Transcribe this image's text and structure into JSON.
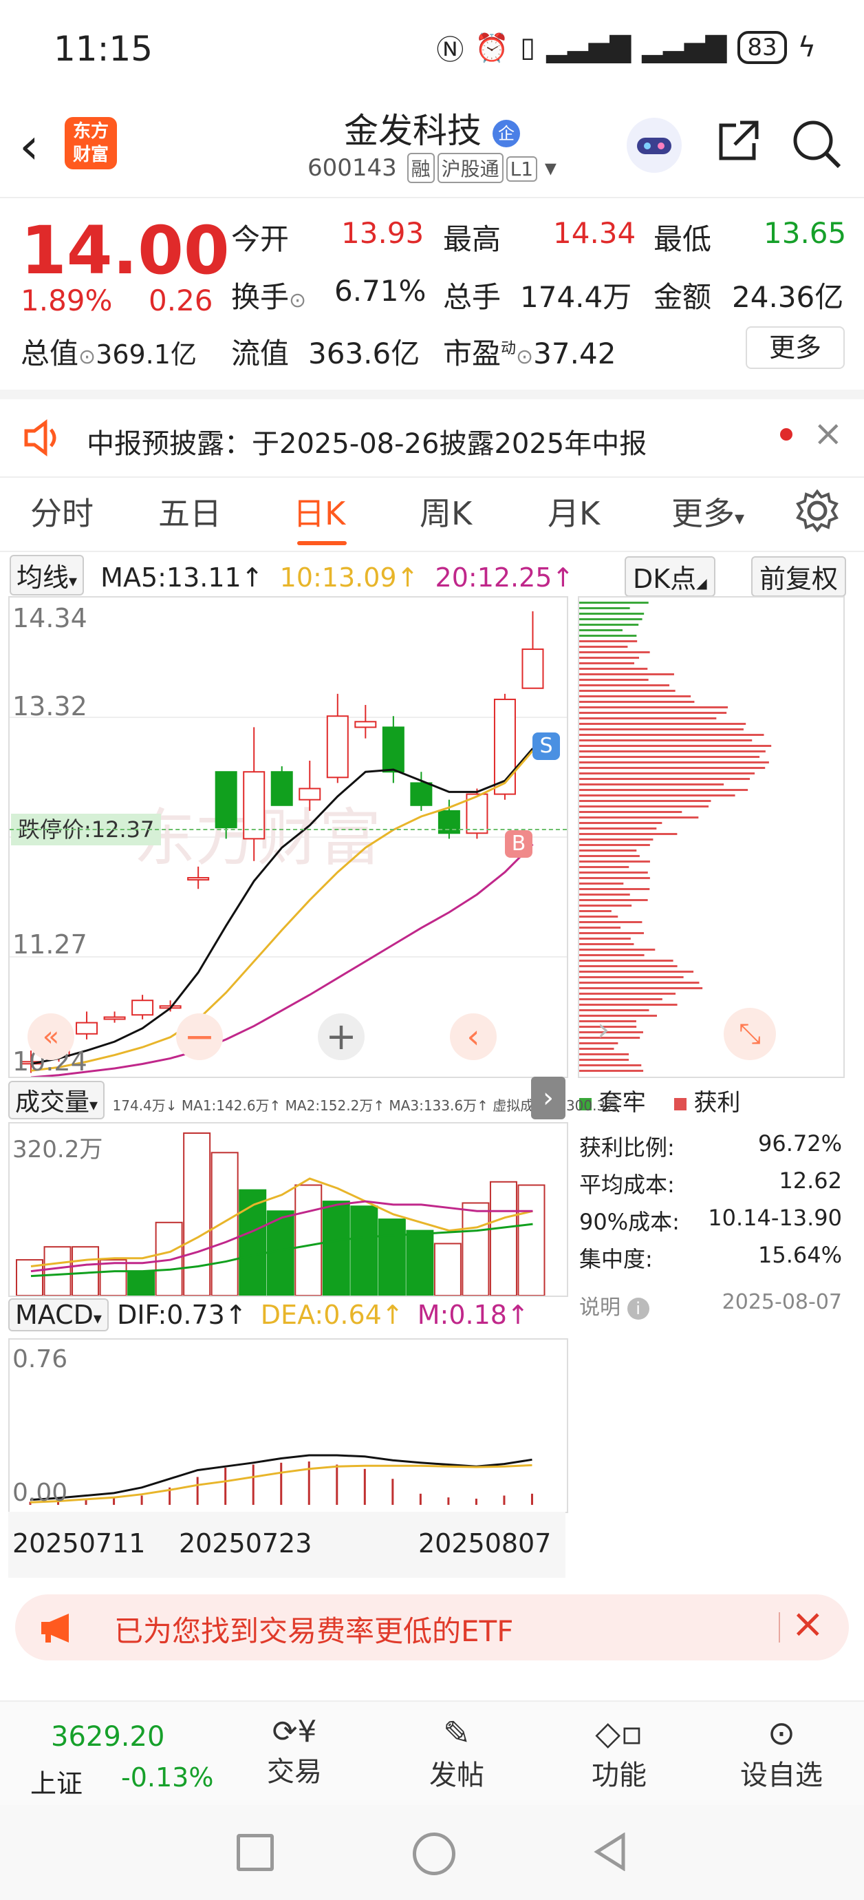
{
  "status": {
    "time": "11:15",
    "battery": "83"
  },
  "header": {
    "logo_line1": "东方",
    "logo_line2": "财富",
    "stock_name": "金发科技",
    "corp_badge": "企",
    "code": "600143",
    "tags": [
      "融",
      "沪股通",
      "L1"
    ]
  },
  "quote": {
    "price": "14.00",
    "change_pct": "1.89%",
    "change": "0.26",
    "open_label": "今开",
    "open": "13.93",
    "high_label": "最高",
    "high": "14.34",
    "low_label": "最低",
    "low": "13.65",
    "turnover_label": "换手",
    "turnover": "6.71%",
    "volume_label": "总手",
    "volume": "174.4万",
    "amount_label": "金额",
    "amount": "24.36亿",
    "mcap_label": "总值",
    "mcap": "369.1亿",
    "float_label": "流值",
    "float": "363.6亿",
    "pe_label": "市盈",
    "pe_sup": "动",
    "pe": "37.42",
    "more": "更多"
  },
  "notice": {
    "text": "中报预披露：于2025-08-26披露2025年中报"
  },
  "tabs": [
    "分时",
    "五日",
    "日K",
    "周K",
    "月K",
    "更多"
  ],
  "ma": {
    "selector": "均线",
    "ma5": "MA5:13.11↑",
    "ma10": "10:13.09↑",
    "ma20": "20:12.25↑",
    "dk": "DK点",
    "adjust": "前复权"
  },
  "kchart": {
    "y_top": "14.34",
    "y_2": "13.32",
    "y_3": "11.27",
    "y_bottom": "10.24",
    "stop_label": "跌停价:12.37",
    "buy_mark": "B",
    "sell_mark": "S"
  },
  "dist": {
    "legend_trapped": "套牢",
    "legend_profit": "获利",
    "stats": [
      {
        "label": "获利比例:",
        "value": "96.72%"
      },
      {
        "label": "平均成本:",
        "value": "12.62"
      },
      {
        "label": "90%成本:",
        "value": "10.14-13.90"
      },
      {
        "label": "集中度:",
        "value": "15.64%"
      }
    ],
    "note_label": "说明",
    "note_date": "2025-08-07"
  },
  "volume": {
    "selector": "成交量",
    "info": "174.4万↓ MA1:142.6万↑ MA2:152.2万↑ MA3:133.6万↑ 虚拟成交量:300.3万",
    "y_top": "320.2万"
  },
  "macd": {
    "selector": "MACD",
    "dif": "DIF:0.73↑",
    "dea": "DEA:0.64↑",
    "m": "M:0.18↑",
    "y_top": "0.76",
    "y_bottom": "0.00"
  },
  "dates": [
    "20250711",
    "20250723",
    "20250807"
  ],
  "etf": {
    "text": "已为您找到交易费率更低的ETF"
  },
  "bottom": {
    "index_value": "3629.20",
    "index_name": "上证",
    "index_change": "-0.13%",
    "items": [
      "交易",
      "发帖",
      "功能",
      "设自选"
    ]
  },
  "chart_data": {
    "type": "candlestick",
    "y_range": [
      10.24,
      14.34
    ],
    "candles": [
      {
        "o": 10.3,
        "c": 10.3,
        "h": 10.4,
        "l": 10.2
      },
      {
        "o": 10.35,
        "c": 10.45,
        "h": 10.55,
        "l": 10.3
      },
      {
        "o": 10.55,
        "c": 10.65,
        "h": 10.75,
        "l": 10.5
      },
      {
        "o": 10.7,
        "c": 10.7,
        "h": 10.75,
        "l": 10.65
      },
      {
        "o": 10.72,
        "c": 10.85,
        "h": 10.9,
        "l": 10.68
      },
      {
        "o": 10.8,
        "c": 10.8,
        "h": 10.85,
        "l": 10.75
      },
      {
        "o": 11.95,
        "c": 11.95,
        "h": 12.05,
        "l": 11.85
      },
      {
        "o": 12.9,
        "c": 12.4,
        "h": 12.9,
        "l": 12.3
      },
      {
        "o": 12.3,
        "c": 12.9,
        "h": 13.3,
        "l": 12.1
      },
      {
        "o": 12.9,
        "c": 12.6,
        "h": 12.95,
        "l": 12.6
      },
      {
        "o": 12.65,
        "c": 12.75,
        "h": 13.0,
        "l": 12.55
      },
      {
        "o": 12.85,
        "c": 13.4,
        "h": 13.6,
        "l": 12.8
      },
      {
        "o": 13.3,
        "c": 13.35,
        "h": 13.5,
        "l": 13.2
      },
      {
        "o": 13.3,
        "c": 12.9,
        "h": 13.4,
        "l": 12.8
      },
      {
        "o": 12.8,
        "c": 12.6,
        "h": 12.9,
        "l": 12.55
      },
      {
        "o": 12.55,
        "c": 12.35,
        "h": 12.65,
        "l": 12.3
      },
      {
        "o": 12.35,
        "c": 12.7,
        "h": 12.75,
        "l": 12.3
      },
      {
        "o": 12.7,
        "c": 13.55,
        "h": 13.6,
        "l": 12.65
      },
      {
        "o": 13.65,
        "c": 14.0,
        "h": 14.34,
        "l": 13.65
      }
    ],
    "ma5": [
      10.28,
      10.33,
      10.4,
      10.48,
      10.6,
      10.78,
      11.1,
      11.52,
      11.92,
      12.22,
      12.42,
      12.68,
      12.9,
      12.92,
      12.82,
      12.72,
      12.72,
      12.82,
      13.11
    ],
    "ma10": [
      10.22,
      10.25,
      10.3,
      10.36,
      10.43,
      10.52,
      10.68,
      10.92,
      11.2,
      11.48,
      11.75,
      12.0,
      12.22,
      12.38,
      12.5,
      12.58,
      12.68,
      12.8,
      13.09
    ],
    "ma20": [
      10.16,
      10.18,
      10.21,
      10.24,
      10.28,
      10.33,
      10.4,
      10.5,
      10.62,
      10.76,
      10.9,
      11.05,
      11.2,
      11.35,
      11.5,
      11.64,
      11.8,
      12.0,
      12.25
    ],
    "volume": [
      0.22,
      0.3,
      0.3,
      0.22,
      0.15,
      0.45,
      1.0,
      0.88,
      0.65,
      0.52,
      0.68,
      0.58,
      0.55,
      0.47,
      0.4,
      0.32,
      0.57,
      0.7,
      0.68
    ],
    "volume_up": [
      true,
      true,
      true,
      true,
      false,
      true,
      true,
      true,
      false,
      false,
      true,
      false,
      false,
      false,
      false,
      true,
      true,
      true,
      true
    ],
    "macd_hist": [
      0.05,
      0.07,
      0.09,
      0.11,
      0.15,
      0.28,
      0.45,
      0.6,
      0.65,
      0.68,
      0.7,
      0.65,
      0.58,
      0.42,
      0.18,
      0.12,
      0.1,
      0.15,
      0.18
    ],
    "dif": [
      0.08,
      0.11,
      0.15,
      0.19,
      0.28,
      0.42,
      0.56,
      0.62,
      0.68,
      0.75,
      0.8,
      0.8,
      0.78,
      0.72,
      0.68,
      0.65,
      0.62,
      0.66,
      0.73
    ],
    "dea": [
      0.04,
      0.06,
      0.09,
      0.12,
      0.17,
      0.24,
      0.32,
      0.38,
      0.45,
      0.52,
      0.58,
      0.62,
      0.63,
      0.63,
      0.63,
      0.62,
      0.61,
      0.62,
      0.64
    ]
  }
}
